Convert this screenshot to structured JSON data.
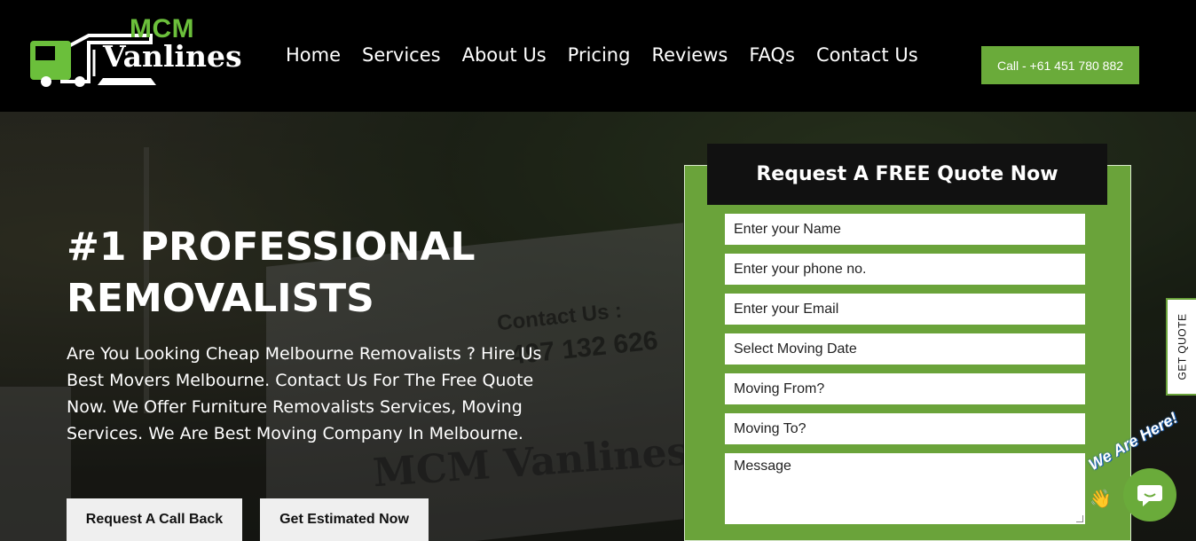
{
  "brand": {
    "name_top": "MCM",
    "name_bottom": "Vanlines",
    "accent": "#6bbf3b"
  },
  "nav": {
    "items": [
      "Home",
      "Services",
      "About Us",
      "Pricing",
      "Reviews",
      "FAQs",
      "Contact Us"
    ]
  },
  "header": {
    "call_label": "Call - +61 451 780 882",
    "call_color": "#6aab3a"
  },
  "background_text": {
    "contact": "Contact Us :",
    "phone": "497 132 626",
    "brand": "MCM Vanlines"
  },
  "hero": {
    "title": "#1 PROFESSIONAL REMOVALISTS",
    "subtitle": "Are You Looking Cheap Melbourne Removalists ? Hire Us Best Movers Melbourne. Contact Us For The Free Quote Now. We Offer Furniture Removalists Services, Moving Services. We Are Best Moving Company In Melbourne.",
    "btn_callback": "Request A Call Back",
    "btn_estimate": "Get Estimated Now"
  },
  "form": {
    "title": "Request A FREE Quote Now",
    "fields": {
      "name": "Enter your Name",
      "phone": "Enter your phone no.",
      "email": "Enter your Email",
      "date": "Select Moving Date",
      "from": "Moving From?",
      "to": "Moving To?",
      "message": "Message"
    },
    "bg_color": "#6aa33a"
  },
  "side_tab": {
    "label": "GET QUOTE"
  },
  "chat": {
    "badge": "We Are Here!",
    "icons": [
      "wave-hand-icon",
      "chat-bubble-icon"
    ]
  }
}
